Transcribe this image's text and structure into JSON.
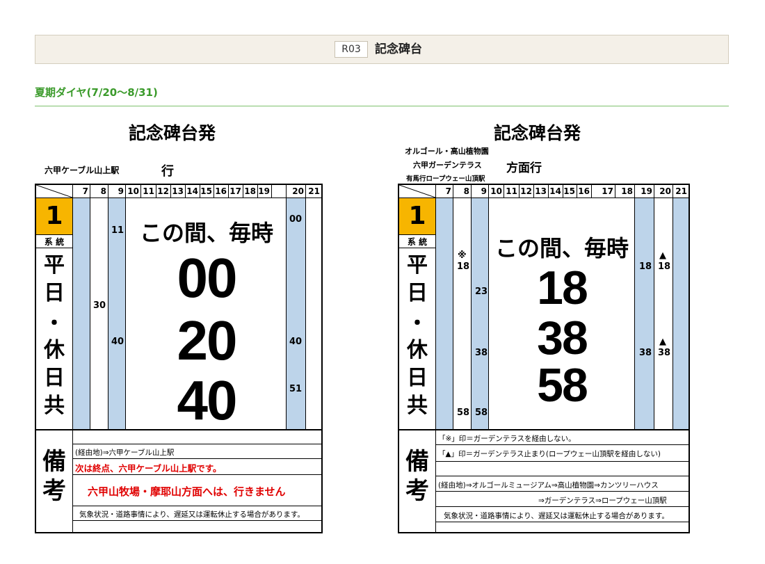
{
  "header": {
    "stop_code": "R03",
    "stop_name": "記念碑台"
  },
  "season": "夏期ダイヤ(7/20〜8/31)",
  "timetables": [
    {
      "title": "記念碑台発",
      "dest_line1": "六甲ケーブル山上駅",
      "dest_suffix": "行",
      "route_no": "1",
      "route_label": "系 統",
      "day_chars": [
        "平",
        "日",
        "・",
        "休",
        "日",
        "共"
      ],
      "hours": [
        "7",
        "8",
        "9",
        "10",
        "11",
        "12",
        "13",
        "14",
        "15",
        "16",
        "17",
        "18",
        "19",
        "20",
        "21"
      ],
      "mins": {
        "h8": "30",
        "h9_a": "11",
        "h9_b": "40",
        "h20_a": "00",
        "h20_b": "40",
        "h20_c": "51"
      },
      "every_hour": "この間、毎時",
      "big_mins": [
        "00",
        "20",
        "40"
      ],
      "biko": [
        "備",
        "考"
      ],
      "notes": [
        "(経由地)⇒六甲ケーブル山上駅",
        "次は終点、六甲ケーブル山上駅です。",
        "六甲山牧場・摩耶山方面へは、行きません",
        "気象状況・道路事情により、遅延又は運転休止する場合があります。"
      ]
    },
    {
      "title": "記念碑台発",
      "dest_line1": "オルゴール・高山植物園",
      "dest_line2": "六甲ガーデンテラス",
      "dest_line3": "有馬行ロープウェー山頂駅",
      "dest_suffix": "方面行",
      "route_no": "1",
      "route_label": "系 統",
      "day_chars": [
        "平",
        "日",
        "・",
        "休",
        "日",
        "共"
      ],
      "hours": [
        "7",
        "8",
        "9",
        "10",
        "11",
        "12",
        "13",
        "14",
        "15",
        "16",
        "17",
        "18",
        "19",
        "20",
        "21"
      ],
      "mins": {
        "h8_mark": "※",
        "h8_a": "18",
        "h8_b": "58",
        "h9_a": "23",
        "h9_b": "38",
        "h9_c": "58",
        "h19_a": "18",
        "h19_b": "38",
        "h20_mark": "▲",
        "h20_a": "18",
        "h20_b": "38"
      },
      "every_hour": "この間、毎時",
      "big_mins": [
        "18",
        "38",
        "58"
      ],
      "biko": [
        "備",
        "考"
      ],
      "notes": [
        "「※」印＝ガーデンテラスを経由しない。",
        "「▲」印＝ガーデンテラス止まり(ロープウェー山頂駅を経由しない)",
        "(経由地)⇒オルゴールミュージアム⇒高山植物園⇒カンツリーハウス",
        "⇒ガーデンテラス⇒ロープウェー山頂駅",
        "気象状況・道路事情により、遅延又は運転休止する場合があります。"
      ]
    }
  ]
}
